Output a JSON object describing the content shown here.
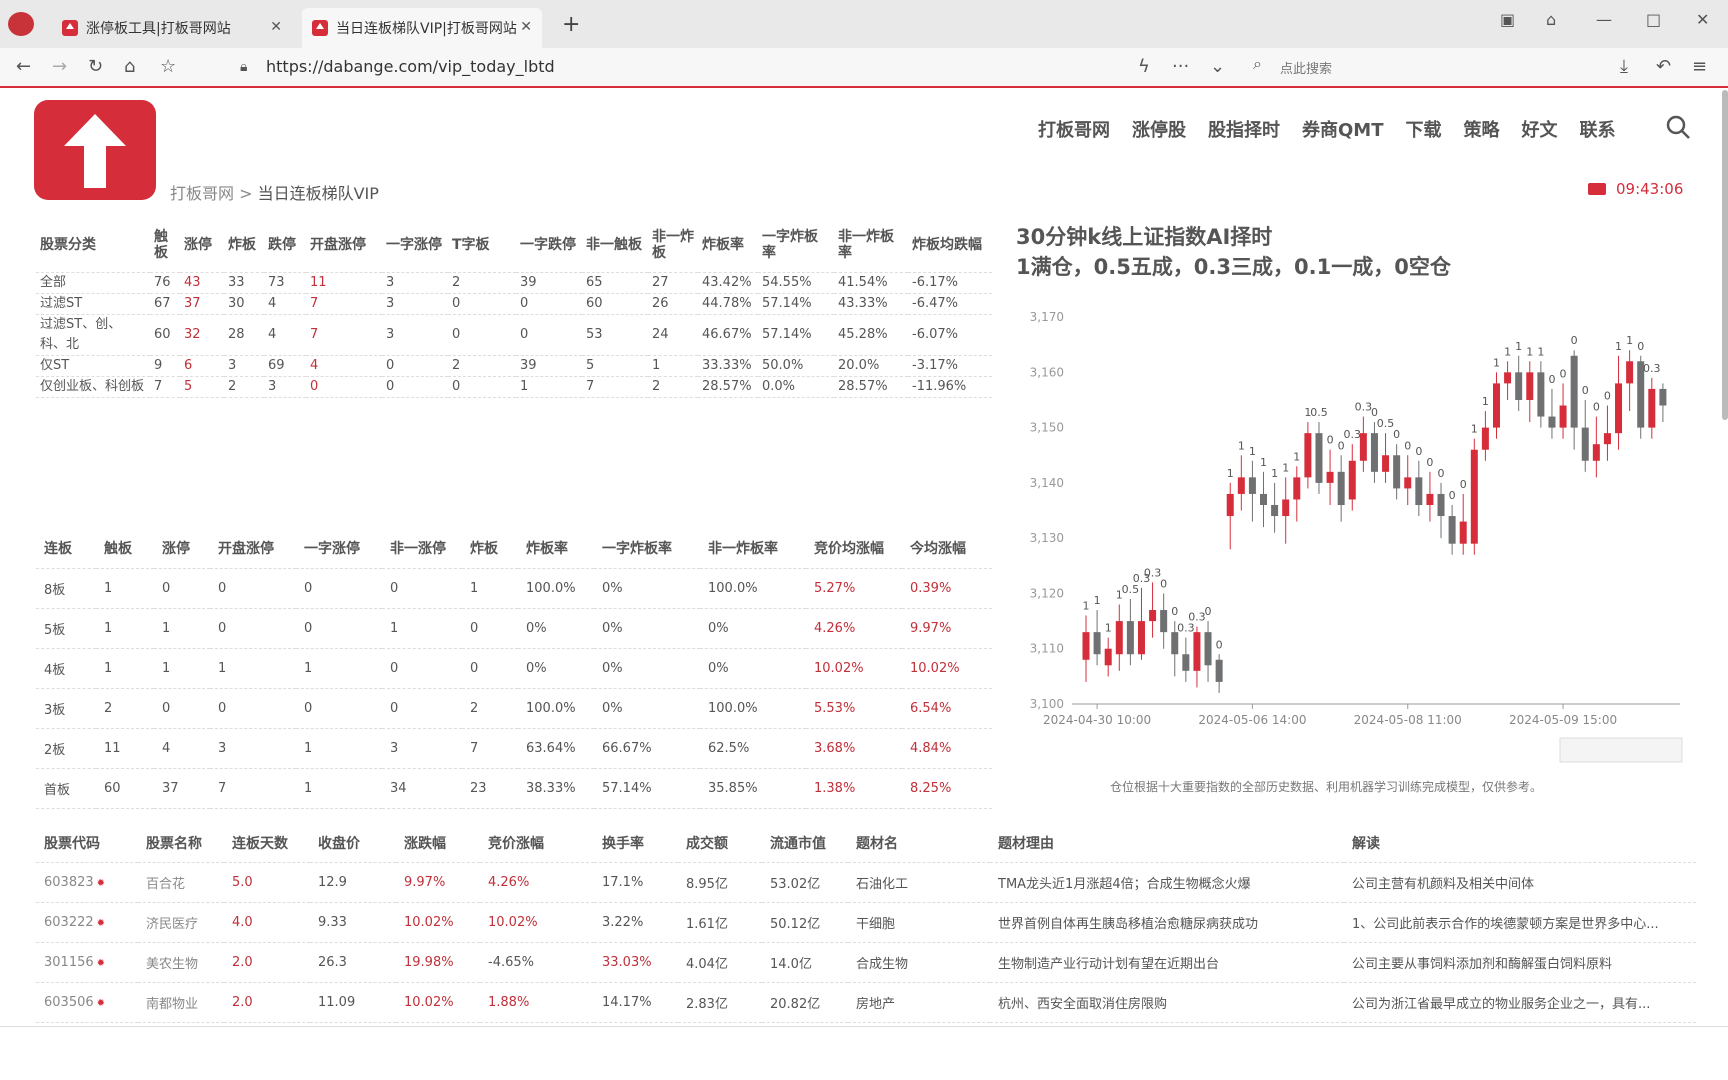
{
  "browser": {
    "tabs": [
      {
        "label": "涨停板工具|打板哥网站"
      },
      {
        "label": "当日连板梯队VIP|打板哥网站"
      }
    ],
    "url": "https://dabange.com/vip_today_lbtd",
    "search_placeholder": "点此搜索"
  },
  "nav": {
    "items": [
      "打板哥网",
      "涨停股",
      "股指择时",
      "券商QMT",
      "下载",
      "策略",
      "好文",
      "联系"
    ]
  },
  "breadcrumb": {
    "home": "打板哥网",
    "sep": " > ",
    "current": "当日连板梯队VIP"
  },
  "clock": "09:43:06",
  "summary_table": {
    "headers": [
      "股票分类",
      "触板",
      "涨停",
      "炸板",
      "跌停",
      "开盘涨停",
      "一字涨停",
      "T字板",
      "一字跌停",
      "非一触板",
      "非一炸板",
      "炸板率",
      "一字炸板率",
      "非一炸板率",
      "炸板均跌幅"
    ],
    "rows": [
      [
        "全部",
        "76",
        "43",
        "33",
        "73",
        "11",
        "3",
        "2",
        "39",
        "65",
        "27",
        "43.42%",
        "54.55%",
        "41.54%",
        "-6.17%"
      ],
      [
        "过滤ST",
        "67",
        "37",
        "30",
        "4",
        "7",
        "3",
        "0",
        "0",
        "60",
        "26",
        "44.78%",
        "57.14%",
        "43.33%",
        "-6.47%"
      ],
      [
        "过滤ST、创、科、北",
        "60",
        "32",
        "28",
        "4",
        "7",
        "3",
        "0",
        "0",
        "53",
        "24",
        "46.67%",
        "57.14%",
        "45.28%",
        "-6.07%"
      ],
      [
        "仅ST",
        "9",
        "6",
        "3",
        "69",
        "4",
        "0",
        "2",
        "39",
        "5",
        "1",
        "33.33%",
        "50.0%",
        "20.0%",
        "-3.17%"
      ],
      [
        "仅创业板、科创板",
        "7",
        "5",
        "2",
        "3",
        "0",
        "0",
        "0",
        "1",
        "7",
        "2",
        "28.57%",
        "0.0%",
        "28.57%",
        "-11.96%"
      ]
    ]
  },
  "ladder_table": {
    "headers": [
      "连板",
      "触板",
      "涨停",
      "开盘涨停",
      "一字涨停",
      "非一涨停",
      "炸板",
      "炸板率",
      "一字炸板率",
      "非一炸板率",
      "竞价均涨幅",
      "今均涨幅"
    ],
    "rows": [
      [
        "8板",
        "1",
        "0",
        "0",
        "0",
        "0",
        "1",
        "100.0%",
        "0%",
        "100.0%",
        "5.27%",
        "0.39%"
      ],
      [
        "5板",
        "1",
        "1",
        "0",
        "0",
        "1",
        "0",
        "0%",
        "0%",
        "0%",
        "4.26%",
        "9.97%"
      ],
      [
        "4板",
        "1",
        "1",
        "1",
        "1",
        "0",
        "0",
        "0%",
        "0%",
        "0%",
        "10.02%",
        "10.02%"
      ],
      [
        "3板",
        "2",
        "0",
        "0",
        "0",
        "0",
        "2",
        "100.0%",
        "0%",
        "100.0%",
        "5.53%",
        "6.54%"
      ],
      [
        "2板",
        "11",
        "4",
        "3",
        "1",
        "3",
        "7",
        "63.64%",
        "66.67%",
        "62.5%",
        "3.68%",
        "4.84%"
      ],
      [
        "首板",
        "60",
        "37",
        "7",
        "1",
        "34",
        "23",
        "38.33%",
        "57.14%",
        "35.85%",
        "1.38%",
        "8.25%"
      ]
    ]
  },
  "stock_table": {
    "headers": [
      "股票代码",
      "股票名称",
      "连板天数",
      "收盘价",
      "涨跌幅",
      "竞价涨幅",
      "换手率",
      "成交额",
      "流通市值",
      "题材名",
      "题材理由",
      "解读"
    ],
    "rows": [
      [
        "603823",
        "百合花",
        "5.0",
        "12.9",
        "9.97%",
        "4.26%",
        "17.1%",
        "8.95亿",
        "53.02亿",
        "石油化工",
        "TMA龙头近1月涨超4倍；合成生物概念火爆",
        "公司主营有机颜料及相关中间体"
      ],
      [
        "603222",
        "济民医疗",
        "4.0",
        "9.33",
        "10.02%",
        "10.02%",
        "3.22%",
        "1.61亿",
        "50.12亿",
        "干细胞",
        "世界首例自体再生胰岛移植治愈糖尿病获成功",
        "1、公司此前表示合作的埃德蒙顿方案是世界多中心..."
      ],
      [
        "301156",
        "美农生物",
        "2.0",
        "26.3",
        "19.98%",
        "-4.65%",
        "33.03%",
        "4.04亿",
        "14.0亿",
        "合成生物",
        "生物制造产业行动计划有望在近期出台",
        "公司主要从事饲料添加剂和酶解蛋白饲料原料"
      ],
      [
        "603506",
        "南都物业",
        "2.0",
        "11.09",
        "10.02%",
        "1.88%",
        "14.17%",
        "2.83亿",
        "20.82亿",
        "房地产",
        "杭州、西安全面取消住房限购",
        "公司为浙江省最早成立的物业服务企业之一，具有..."
      ]
    ]
  },
  "chart_title_line1": "30分钟k线上证指数AI择时",
  "chart_title_line2": "1满仓，0.5五成，0.3三成，0.1一成，0空仓",
  "chart_note": "仓位根据十大重要指数的全部历史数据、利用机器学习训练完成模型，仅供参考。",
  "colors": {
    "brand": "#d62d3b",
    "up": "#d62d3b",
    "down": "#6e7072"
  },
  "chart_data": {
    "type": "candlestick",
    "y_ticks": [
      "3,100",
      "3,110",
      "3,120",
      "3,130",
      "3,140",
      "3,150",
      "3,160",
      "3,170"
    ],
    "ylim": [
      3100,
      3172
    ],
    "x_ticks": [
      "2024-04-30 10:00",
      "2024-05-06 14:00",
      "2024-05-08 11:00",
      "2024-05-09 15:00"
    ],
    "x_tick_index": [
      1,
      15,
      29,
      43
    ],
    "candles": [
      {
        "o": 3108,
        "c": 3113,
        "h": 3116,
        "l": 3104,
        "pos": "1"
      },
      {
        "o": 3113,
        "c": 3109,
        "h": 3117,
        "l": 3107,
        "pos": "1"
      },
      {
        "o": 3107,
        "c": 3110,
        "h": 3112,
        "l": 3105,
        "pos": "1"
      },
      {
        "o": 3109,
        "c": 3115,
        "h": 3118,
        "l": 3106,
        "pos": "1"
      },
      {
        "o": 3115,
        "c": 3109,
        "h": 3119,
        "l": 3107,
        "pos": "0.5"
      },
      {
        "o": 3109,
        "c": 3115,
        "h": 3121,
        "l": 3108,
        "pos": "0.3"
      },
      {
        "o": 3115,
        "c": 3117,
        "h": 3122,
        "l": 3112,
        "pos": "0.3"
      },
      {
        "o": 3117,
        "c": 3113,
        "h": 3120,
        "l": 3110,
        "pos": "0"
      },
      {
        "o": 3113,
        "c": 3109,
        "h": 3115,
        "l": 3105,
        "pos": "0"
      },
      {
        "o": 3109,
        "c": 3106,
        "h": 3112,
        "l": 3104,
        "pos": "0.3"
      },
      {
        "o": 3106,
        "c": 3113,
        "h": 3114,
        "l": 3103,
        "pos": "0.3"
      },
      {
        "o": 3113,
        "c": 3107,
        "h": 3115,
        "l": 3104,
        "pos": "0"
      },
      {
        "o": 3108,
        "c": 3104,
        "h": 3109,
        "l": 3102,
        "pos": "0"
      },
      {
        "o": 3134,
        "c": 3138,
        "h": 3140,
        "l": 3128,
        "pos": "1"
      },
      {
        "o": 3138,
        "c": 3141,
        "h": 3145,
        "l": 3135,
        "pos": "1"
      },
      {
        "o": 3141,
        "c": 3138,
        "h": 3144,
        "l": 3133,
        "pos": "1"
      },
      {
        "o": 3138,
        "c": 3136,
        "h": 3142,
        "l": 3132,
        "pos": "1"
      },
      {
        "o": 3136,
        "c": 3134,
        "h": 3140,
        "l": 3131,
        "pos": "1"
      },
      {
        "o": 3134,
        "c": 3137,
        "h": 3141,
        "l": 3129,
        "pos": "1"
      },
      {
        "o": 3137,
        "c": 3141,
        "h": 3143,
        "l": 3133,
        "pos": "1"
      },
      {
        "o": 3141,
        "c": 3149,
        "h": 3151,
        "l": 3139,
        "pos": "1"
      },
      {
        "o": 3149,
        "c": 3140,
        "h": 3151,
        "l": 3138,
        "pos": "0.5"
      },
      {
        "o": 3140,
        "c": 3142,
        "h": 3146,
        "l": 3136,
        "pos": "0"
      },
      {
        "o": 3142,
        "c": 3136,
        "h": 3145,
        "l": 3133,
        "pos": "0"
      },
      {
        "o": 3137,
        "c": 3144,
        "h": 3147,
        "l": 3135,
        "pos": "0.3"
      },
      {
        "o": 3144,
        "c": 3149,
        "h": 3152,
        "l": 3142,
        "pos": "0.3"
      },
      {
        "o": 3149,
        "c": 3142,
        "h": 3151,
        "l": 3140,
        "pos": "0"
      },
      {
        "o": 3142,
        "c": 3145,
        "h": 3149,
        "l": 3140,
        "pos": "0.5"
      },
      {
        "o": 3145,
        "c": 3139,
        "h": 3147,
        "l": 3137,
        "pos": "0"
      },
      {
        "o": 3139,
        "c": 3141,
        "h": 3145,
        "l": 3136,
        "pos": "0"
      },
      {
        "o": 3141,
        "c": 3136,
        "h": 3144,
        "l": 3134,
        "pos": "0"
      },
      {
        "o": 3136,
        "c": 3138,
        "h": 3142,
        "l": 3133,
        "pos": "0"
      },
      {
        "o": 3138,
        "c": 3134,
        "h": 3140,
        "l": 3130,
        "pos": "0"
      },
      {
        "o": 3134,
        "c": 3129,
        "h": 3136,
        "l": 3127,
        "pos": "0"
      },
      {
        "o": 3129,
        "c": 3133,
        "h": 3138,
        "l": 3127,
        "pos": "0"
      },
      {
        "o": 3129,
        "c": 3146,
        "h": 3148,
        "l": 3127,
        "pos": "1"
      },
      {
        "o": 3146,
        "c": 3150,
        "h": 3153,
        "l": 3144,
        "pos": "1"
      },
      {
        "o": 3150,
        "c": 3158,
        "h": 3160,
        "l": 3148,
        "pos": "1"
      },
      {
        "o": 3158,
        "c": 3160,
        "h": 3162,
        "l": 3155,
        "pos": "1"
      },
      {
        "o": 3160,
        "c": 3155,
        "h": 3163,
        "l": 3153,
        "pos": "1"
      },
      {
        "o": 3155,
        "c": 3160,
        "h": 3162,
        "l": 3151,
        "pos": "1"
      },
      {
        "o": 3160,
        "c": 3152,
        "h": 3162,
        "l": 3150,
        "pos": "1"
      },
      {
        "o": 3152,
        "c": 3150,
        "h": 3157,
        "l": 3148,
        "pos": "0"
      },
      {
        "o": 3150,
        "c": 3154,
        "h": 3158,
        "l": 3148,
        "pos": "0"
      },
      {
        "o": 3163,
        "c": 3150,
        "h": 3164,
        "l": 3146,
        "pos": "0"
      },
      {
        "o": 3150,
        "c": 3144,
        "h": 3155,
        "l": 3142,
        "pos": "0"
      },
      {
        "o": 3144,
        "c": 3147,
        "h": 3152,
        "l": 3141,
        "pos": "0"
      },
      {
        "o": 3147,
        "c": 3149,
        "h": 3154,
        "l": 3144,
        "pos": "0"
      },
      {
        "o": 3149,
        "c": 3158,
        "h": 3163,
        "l": 3146,
        "pos": "1"
      },
      {
        "o": 3158,
        "c": 3162,
        "h": 3164,
        "l": 3153,
        "pos": "1"
      },
      {
        "o": 3162,
        "c": 3150,
        "h": 3163,
        "l": 3148,
        "pos": "0"
      },
      {
        "o": 3150,
        "c": 3157,
        "h": 3159,
        "l": 3148,
        "pos": "0.3"
      },
      {
        "o": 3157,
        "c": 3154,
        "h": 3158,
        "l": 3151,
        "pos": ""
      }
    ]
  }
}
